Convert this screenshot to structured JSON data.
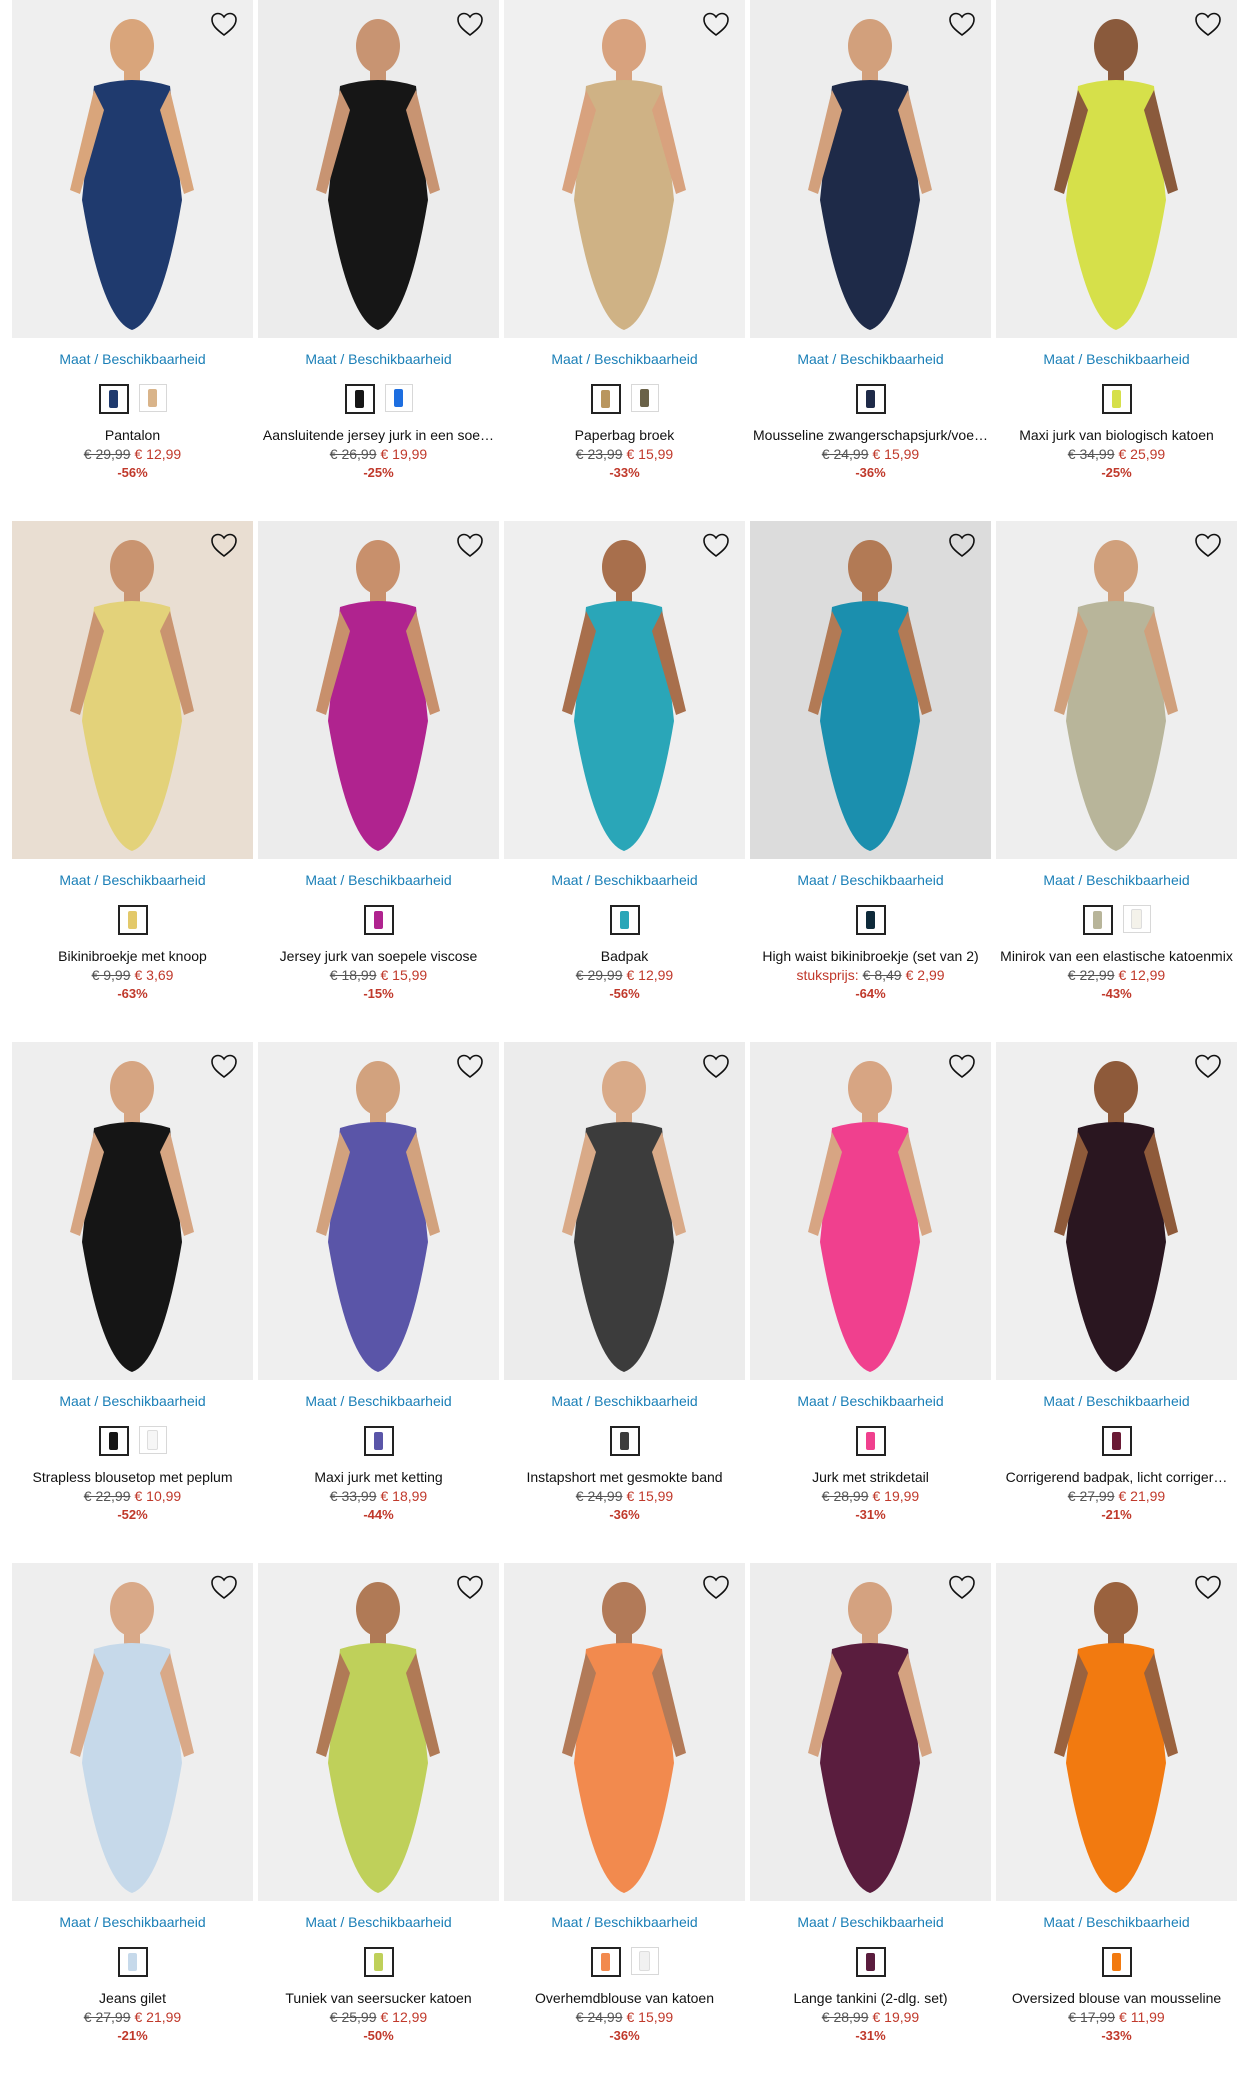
{
  "size_link_text": "Maat / Beschikbaarheid",
  "products": [
    {
      "name": "Pantalon",
      "old_price": "€ 29,99",
      "new_price": "€ 12,99",
      "discount": "-56%",
      "prefix": "",
      "bg": "#efefef",
      "main": "#1f3a6e",
      "skin": "#d9a57b",
      "swatches": [
        "#1f3a6e",
        "#d9b48a"
      ]
    },
    {
      "name": "Aansluitende jersey jurk in een soe…",
      "old_price": "€ 26,99",
      "new_price": "€ 19,99",
      "discount": "-25%",
      "prefix": "",
      "bg": "#ececec",
      "main": "#161616",
      "skin": "#c89472",
      "swatches": [
        "#161616",
        "#1d6ee0"
      ]
    },
    {
      "name": "Paperbag broek",
      "old_price": "€ 23,99",
      "new_price": "€ 15,99",
      "discount": "-33%",
      "prefix": "",
      "bg": "#f0f0f0",
      "main": "#cfb285",
      "skin": "#d8a27e",
      "swatches": [
        "#b9965f",
        "#6a6248"
      ]
    },
    {
      "name": "Mousseline zwangerschapsjurk/voe…",
      "old_price": "€ 24,99",
      "new_price": "€ 15,99",
      "discount": "-36%",
      "prefix": "",
      "bg": "#ededed",
      "main": "#1e2a48",
      "skin": "#d2a07c",
      "swatches": [
        "#1e2a48"
      ]
    },
    {
      "name": "Maxi jurk van biologisch katoen",
      "old_price": "€ 34,99",
      "new_price": "€ 25,99",
      "discount": "-25%",
      "prefix": "",
      "bg": "#eeeeee",
      "main": "#d6e04a",
      "skin": "#8a5a3c",
      "swatches": [
        "#d6e04a"
      ]
    },
    {
      "name": "Bikinibroekje met knoop",
      "old_price": "€ 9,99",
      "new_price": "€ 3,69",
      "discount": "-63%",
      "prefix": "",
      "bg": "#e9ded2",
      "main": "#e3d27a",
      "skin": "#c99470",
      "swatches": [
        "#e3c96a"
      ]
    },
    {
      "name": "Jersey jurk van soepele viscose",
      "old_price": "€ 18,99",
      "new_price": "€ 15,99",
      "discount": "-15%",
      "prefix": "",
      "bg": "#ececec",
      "main": "#b0238f",
      "skin": "#c8906c",
      "swatches": [
        "#b0238f"
      ]
    },
    {
      "name": "Badpak",
      "old_price": "€ 29,99",
      "new_price": "€ 12,99",
      "discount": "-56%",
      "prefix": "",
      "bg": "#efefef",
      "main": "#2aa6b8",
      "skin": "#a86f4c",
      "swatches": [
        "#2aa6b8"
      ]
    },
    {
      "name": "High waist bikinibroekje (set van 2)",
      "old_price": "€ 8,49",
      "new_price": "€ 2,99",
      "discount": "-64%",
      "prefix": "stuksprijs:",
      "bg": "#dcdcdc",
      "main": "#1b8fae",
      "skin": "#b27a55",
      "swatches": [
        "#0e2a3a"
      ]
    },
    {
      "name": "Minirok van een elastische katoenmix",
      "old_price": "€ 22,99",
      "new_price": "€ 12,99",
      "discount": "-43%",
      "prefix": "",
      "bg": "#eeeeee",
      "main": "#b8b59a",
      "skin": "#d0a07c",
      "swatches": [
        "#b8b59a",
        "#f4f2ea"
      ]
    },
    {
      "name": "Strapless blousetop met peplum",
      "old_price": "€ 22,99",
      "new_price": "€ 10,99",
      "discount": "-52%",
      "prefix": "",
      "bg": "#eeeeee",
      "main": "#151515",
      "skin": "#d6a582",
      "swatches": [
        "#151515",
        "#f6f6f6"
      ]
    },
    {
      "name": "Maxi jurk met ketting",
      "old_price": "€ 33,99",
      "new_price": "€ 18,99",
      "discount": "-44%",
      "prefix": "",
      "bg": "#efefef",
      "main": "#5a55a8",
      "skin": "#d2a27e",
      "swatches": [
        "#5a55a8"
      ]
    },
    {
      "name": "Instapshort met gesmokte band",
      "old_price": "€ 24,99",
      "new_price": "€ 15,99",
      "discount": "-36%",
      "prefix": "",
      "bg": "#ececec",
      "main": "#3c3c3c",
      "skin": "#d9aa88",
      "swatches": [
        "#3c3c3c"
      ]
    },
    {
      "name": "Jurk met strikdetail",
      "old_price": "€ 28,99",
      "new_price": "€ 19,99",
      "discount": "-31%",
      "prefix": "",
      "bg": "#ededed",
      "main": "#f0408e",
      "skin": "#d7a583",
      "swatches": [
        "#f0408e"
      ]
    },
    {
      "name": "Corrigerend badpak, licht corriger…",
      "old_price": "€ 27,99",
      "new_price": "€ 21,99",
      "discount": "-21%",
      "prefix": "",
      "bg": "#efefef",
      "main": "#2a1620",
      "skin": "#8e5a3a",
      "swatches": [
        "#6a1a35"
      ]
    },
    {
      "name": "Jeans gilet",
      "old_price": "€ 27,99",
      "new_price": "€ 21,99",
      "discount": "-21%",
      "prefix": "",
      "bg": "#eeeeee",
      "main": "#c6d9ea",
      "skin": "#d9a988",
      "swatches": [
        "#c6d9ea"
      ]
    },
    {
      "name": "Tuniek van seersucker katoen",
      "old_price": "€ 25,99",
      "new_price": "€ 12,99",
      "discount": "-50%",
      "prefix": "",
      "bg": "#efefef",
      "main": "#bfd05a",
      "skin": "#b07a56",
      "swatches": [
        "#bfd05a"
      ]
    },
    {
      "name": "Overhemdblouse van katoen",
      "old_price": "€ 24,99",
      "new_price": "€ 15,99",
      "discount": "-36%",
      "prefix": "",
      "bg": "#eeeeee",
      "main": "#f28a4e",
      "skin": "#b27a58",
      "swatches": [
        "#f28a4e",
        "#f1f1f1"
      ]
    },
    {
      "name": "Lange tankini (2-dlg. set)",
      "old_price": "€ 28,99",
      "new_price": "€ 19,99",
      "discount": "-31%",
      "prefix": "",
      "bg": "#ededed",
      "main": "#5a1d3e",
      "skin": "#d4a280",
      "swatches": [
        "#5a1d3e"
      ]
    },
    {
      "name": "Oversized blouse van mousseline",
      "old_price": "€ 17,99",
      "new_price": "€ 11,99",
      "discount": "-33%",
      "prefix": "",
      "bg": "#efefef",
      "main": "#f27a10",
      "skin": "#9a623e",
      "swatches": [
        "#f27a10"
      ]
    }
  ]
}
